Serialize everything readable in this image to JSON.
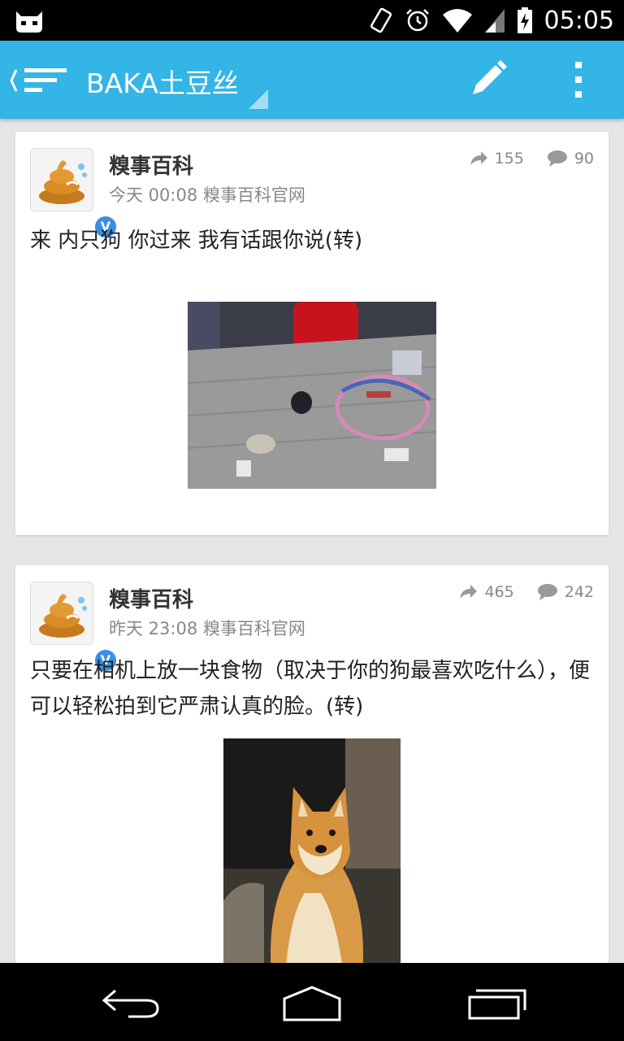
{
  "status_bar": {
    "time": "05:05",
    "icons": [
      "cyanogen-icon",
      "rotate-icon",
      "alarm-icon",
      "wifi-icon",
      "signal-icon",
      "battery-icon"
    ]
  },
  "action_bar": {
    "title": "BAKA土豆丝",
    "icons": [
      "drawer-icon",
      "edit-icon",
      "overflow-icon"
    ],
    "color": "#33b5e5"
  },
  "posts": [
    {
      "author": "糗事百科",
      "time": "今天 00:08",
      "source": "糗事百科官网",
      "reposts": "155",
      "comments": "90",
      "text": "来  内只狗  你过来 我有话跟你说(转)",
      "verified": "V"
    },
    {
      "author": "糗事百科",
      "time": "昨天 23:08",
      "source": "糗事百科官网",
      "reposts": "465",
      "comments": "242",
      "text": "只要在相机上放一块食物（取决于你的狗最喜欢吃什么），便可以轻松拍到它严肃认真的脸。(转)",
      "verified": "V"
    }
  ],
  "nav_bar": {
    "icons": [
      "back-icon",
      "home-icon",
      "recent-apps-icon"
    ]
  }
}
